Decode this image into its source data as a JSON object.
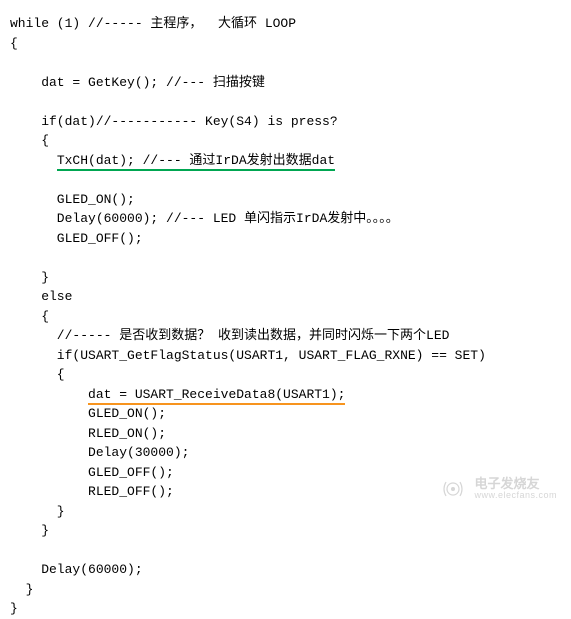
{
  "code": {
    "l1": "while (1) //----- 主程序，  大循环 LOOP",
    "l2": "{",
    "l3": "",
    "l4": "    dat = GetKey(); //--- 扫描按键",
    "l5": "",
    "l6": "    if(dat)//----------- Key(S4) is press?",
    "l7": "    {",
    "l8_pre": "      ",
    "l8_u": "TxCH(dat); //--- 通过IrDA发射出数据dat",
    "l9": "",
    "l10": "      GLED_ON();",
    "l11": "      Delay(60000); //--- LED 单闪指示IrDA发射中。。。。",
    "l12": "      GLED_OFF();",
    "l13": "",
    "l14": "    }",
    "l15": "    else",
    "l16": "    {",
    "l17": "      //----- 是否收到数据？ 收到读出数据，并同时闪烁一下两个LED",
    "l18": "      if(USART_GetFlagStatus(USART1, USART_FLAG_RXNE) == SET)",
    "l19": "      {",
    "l20_pre": "          ",
    "l20_u": "dat = USART_ReceiveData8(USART1);",
    "l21": "          GLED_ON();",
    "l22": "          RLED_ON();",
    "l23": "          Delay(30000);",
    "l24": "          GLED_OFF();",
    "l25": "          RLED_OFF();",
    "l26": "      }",
    "l27": "    }",
    "l28": "",
    "l29": "    Delay(60000);",
    "l30": "  }",
    "l31": "}"
  },
  "watermark": {
    "cn": "电子发烧友",
    "en": "www.elecfans.com"
  }
}
